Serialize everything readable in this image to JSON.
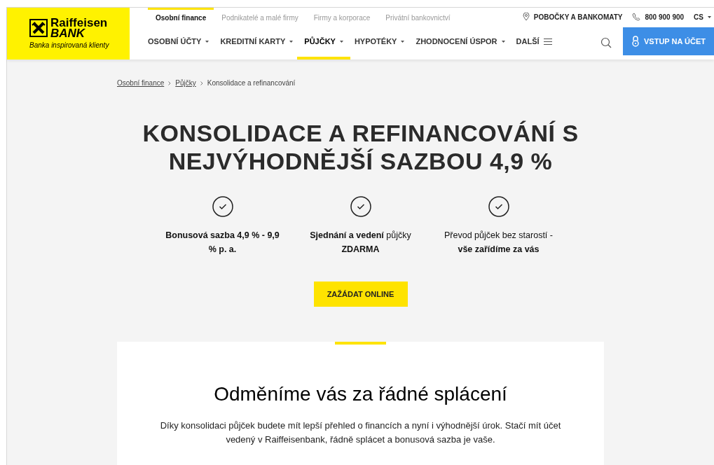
{
  "logo": {
    "name": "Raiffeisen",
    "name_line2": "BANK",
    "tagline": "Banka inspirovaná klienty"
  },
  "segments": [
    {
      "label": "Osobní finance",
      "selected": true
    },
    {
      "label": "Podnikatelé a malé firmy",
      "selected": false
    },
    {
      "label": "Firmy a korporace",
      "selected": false
    },
    {
      "label": "Privátní bankovnictví",
      "selected": false
    }
  ],
  "utility": {
    "branches": "POBOČKY A BANKOMATY",
    "phone": "800 900 900",
    "language": "CS"
  },
  "nav": [
    {
      "label": "OSOBNÍ ÚČTY",
      "kind": "dropdown",
      "selected": false
    },
    {
      "label": "KREDITNÍ KARTY",
      "kind": "dropdown",
      "selected": false
    },
    {
      "label": "PŮJČKY",
      "kind": "dropdown",
      "selected": true
    },
    {
      "label": "HYPOTÉKY",
      "kind": "dropdown",
      "selected": false
    },
    {
      "label": "ZHODNOCENÍ ÚSPOR",
      "kind": "dropdown",
      "selected": false
    },
    {
      "label": "DALŠÍ",
      "kind": "menu",
      "selected": false
    }
  ],
  "login_button": "VSTUP NA ÚČET",
  "breadcrumbs": [
    {
      "label": "Osobní finance",
      "kind": "link"
    },
    {
      "label": "Půjčky",
      "kind": "link"
    },
    {
      "label": "Konsolidace a refinancování",
      "kind": "current"
    }
  ],
  "title_lines": [
    "KONSOLIDACE A REFINANCOVÁNÍ S",
    "NEJVÝHODNĚJŠÍ SAZBOU 4,9 %"
  ],
  "features": [
    {
      "lines": [
        "**Bonusová sazba 4,9 % - 9,9**",
        "**% p. a.**"
      ]
    },
    {
      "lines": [
        "**Sjednání a vedení** půjčky",
        "**ZDARMA**"
      ]
    },
    {
      "lines": [
        "Převod půjček bez starostí -",
        "**vše zařídíme za vás**"
      ]
    }
  ],
  "cta_button": "ZAŽÁDAT ONLINE",
  "card": {
    "heading": "Odměníme vás za řádné splácení",
    "paragraph_lines": [
      "Díky konsolidaci půjček budete mít lepší přehled o financích a nyní i výhodnější úrok. Stačí mít účet",
      "vedený v Raiffeisenbank, řádně splácet a bonusová sazba je vaše."
    ]
  }
}
